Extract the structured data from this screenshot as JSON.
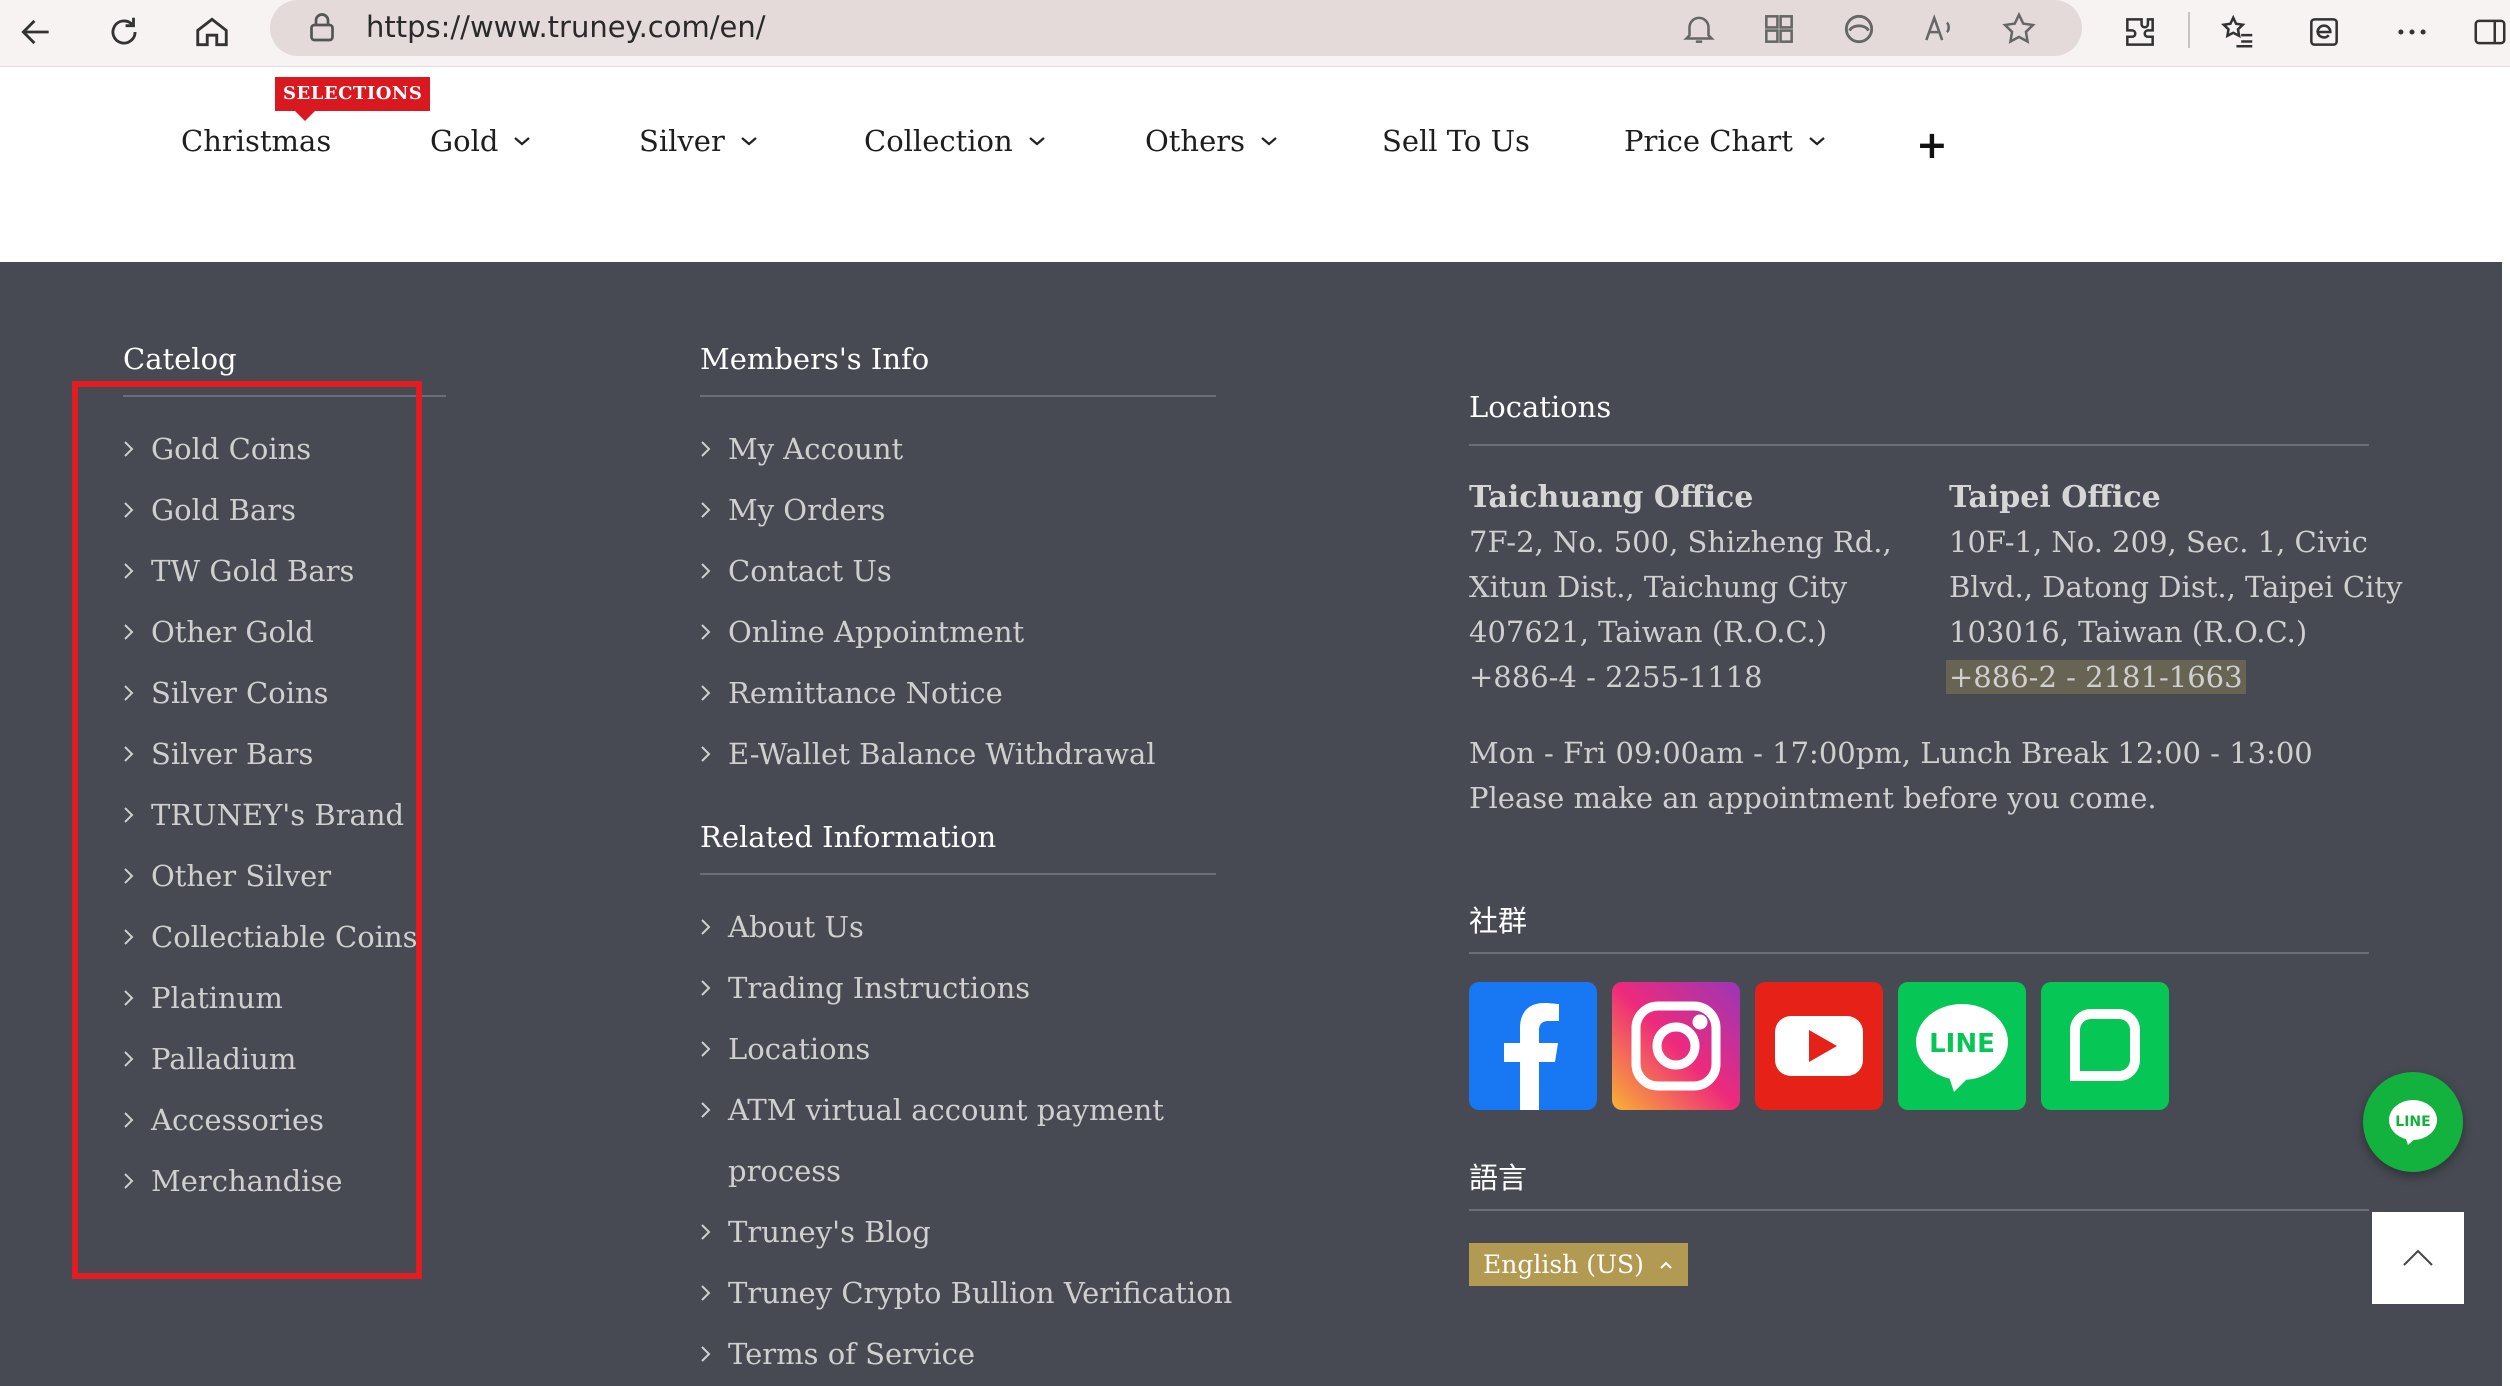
{
  "browser": {
    "url": "https://www.truney.com/en/",
    "icons": [
      "back-icon",
      "refresh-icon",
      "home-icon",
      "lock-icon",
      "notification-icon",
      "apps-icon",
      "edge-icon",
      "read-aloud-icon",
      "favorite-star-icon",
      "extensions-icon",
      "favorites-list-icon",
      "collections-icon",
      "more-icon",
      "sidebar-icon"
    ]
  },
  "nav": {
    "badge": "SELECTIONS",
    "items": [
      {
        "label": "Christmas",
        "dropdown": false
      },
      {
        "label": "Gold",
        "dropdown": true
      },
      {
        "label": "Silver",
        "dropdown": true
      },
      {
        "label": "Collection",
        "dropdown": true
      },
      {
        "label": "Others",
        "dropdown": true
      },
      {
        "label": "Sell To Us",
        "dropdown": false
      },
      {
        "label": "Price Chart",
        "dropdown": true
      }
    ],
    "plus_icon": "+"
  },
  "footer": {
    "catalog": {
      "title": "Catelog",
      "links": [
        "Gold Coins",
        "Gold Bars",
        "TW Gold Bars",
        "Other Gold",
        "Silver Coins",
        "Silver Bars",
        "TRUNEY's Brand",
        "Other Silver",
        "Collectiable Coins",
        "Platinum",
        "Palladium",
        "Accessories",
        "Merchandise"
      ]
    },
    "members": {
      "title": "Members's Info",
      "links": [
        "My Account",
        "My Orders",
        "Contact Us",
        "Online Appointment",
        "Remittance Notice",
        "E-Wallet Balance Withdrawal"
      ]
    },
    "related": {
      "title": "Related Information",
      "links": [
        "About Us",
        "Trading Instructions",
        "Locations",
        "ATM virtual account payment",
        "process",
        "Truney's Blog",
        "Truney Crypto Bullion Verification",
        "Terms of Service"
      ]
    },
    "locations": {
      "title": "Locations",
      "taichung": {
        "name": "Taichuang Office",
        "lines": [
          "7F-2, No. 500, Shizheng Rd.,",
          "Xitun Dist., Taichung City",
          "407621, Taiwan (R.O.C.)",
          "+886-4 - 2255-1118"
        ]
      },
      "taipei": {
        "name": "Taipei Office",
        "lines": [
          "10F-1, No. 209, Sec. 1, Civic",
          "Blvd., Datong Dist., Taipei City",
          "103016, Taiwan (R.O.C.)",
          "+886-2 - 2181-1663"
        ]
      },
      "hours": "Mon - Fri 09:00am - 17:00pm, Lunch Break 12:00 - 13:00",
      "note": "Please make an appointment before you come."
    },
    "social": {
      "title": "社群",
      "items": [
        "facebook-icon",
        "instagram-icon",
        "youtube-icon",
        "line-icon",
        "line-today-icon"
      ],
      "line_label": "LINE"
    },
    "language": {
      "title": "語言",
      "selected": "English (US)"
    },
    "floating_line_label": "LINE"
  },
  "colors": {
    "footer_bg": "#474a52",
    "badge_red": "#d9191f",
    "highlight_red": "#e31c22",
    "lang_gold": "#b29a52",
    "line_green": "#13b13d"
  }
}
